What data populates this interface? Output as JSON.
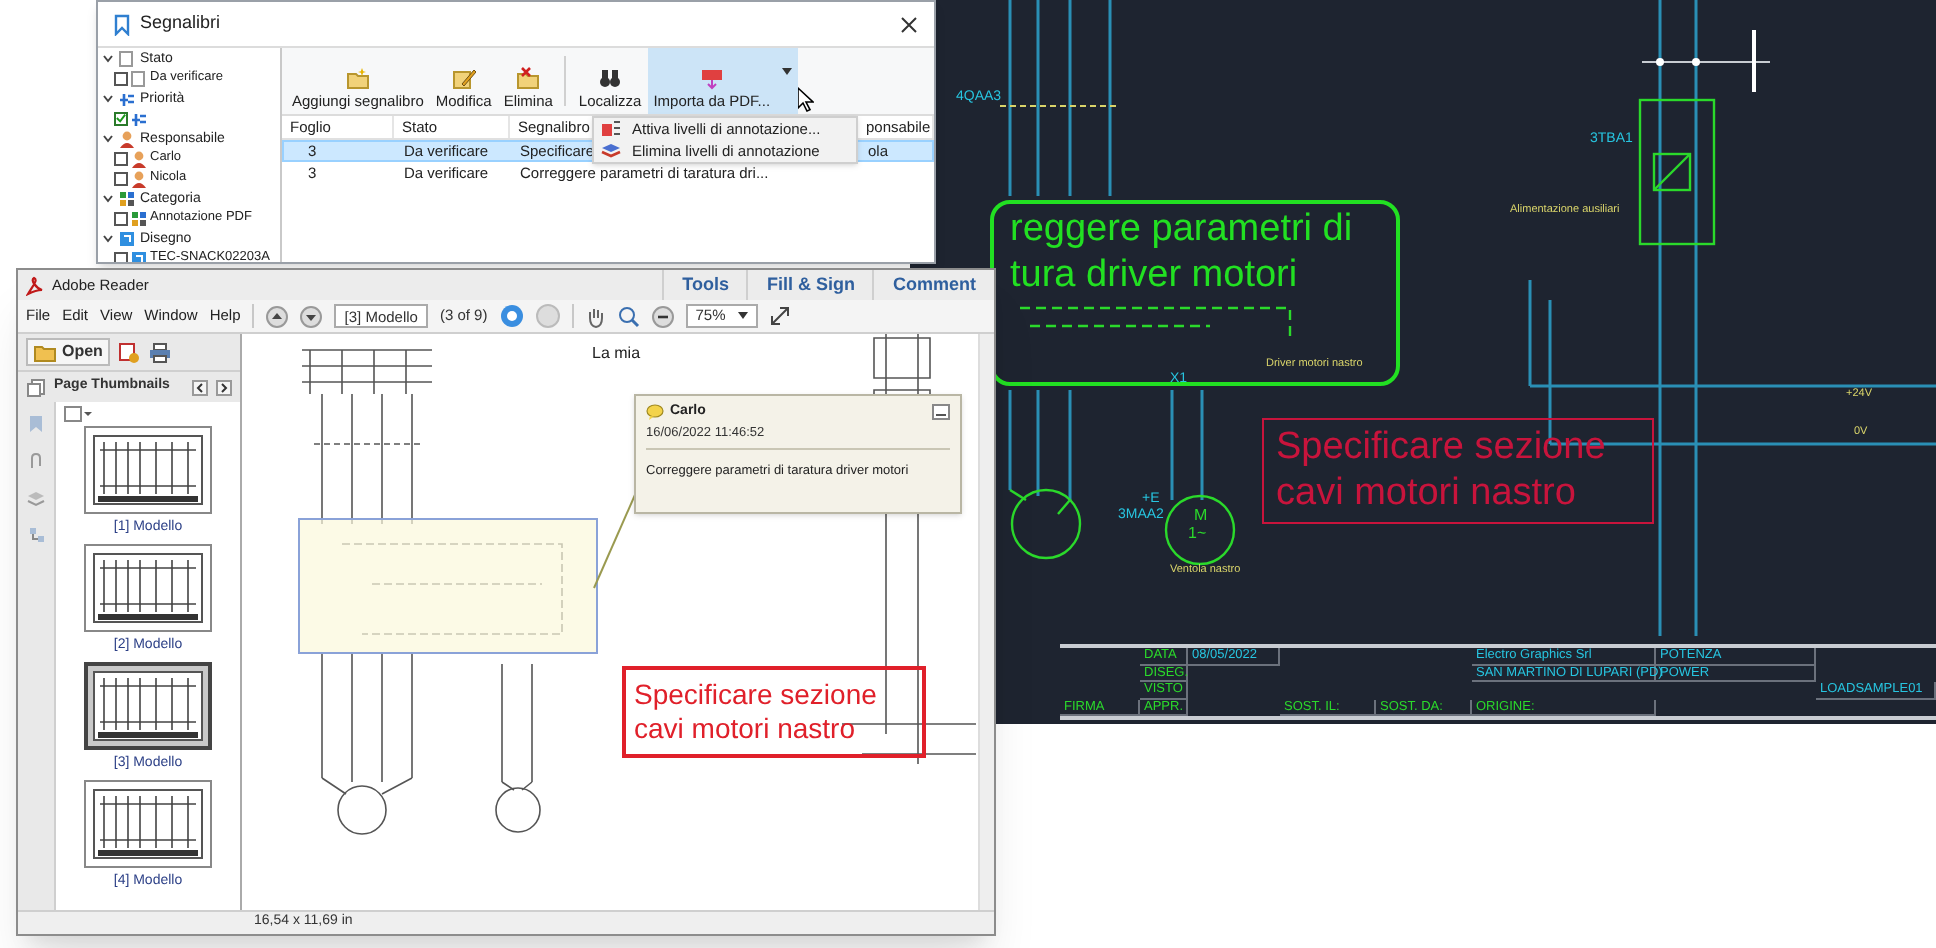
{
  "cad_drawing": {
    "labels": [
      {
        "text": "4QAA3",
        "kind": "tag"
      },
      {
        "text": "3TBA1",
        "kind": "tag"
      },
      {
        "text": "Alimentazione ausiliari",
        "kind": "note"
      },
      {
        "text": "Driver motori nastro",
        "kind": "note"
      },
      {
        "text": "X1",
        "kind": "tag"
      },
      {
        "text": "+E",
        "kind": "tag"
      },
      {
        "text": "3MAA2",
        "kind": "tag"
      },
      {
        "text": "M",
        "kind": "symbol"
      },
      {
        "text": "1~",
        "kind": "symbol"
      },
      {
        "text": "Ventola nastro",
        "kind": "note"
      },
      {
        "text": "+24V",
        "kind": "note"
      },
      {
        "text": "0V",
        "kind": "note"
      }
    ],
    "notes": [
      {
        "text": "reggere parametri di\ntura driver motori",
        "color": "#22e022"
      },
      {
        "text": "Specificare sezione\ncavi motori nastro",
        "color": "#c8143c"
      }
    ],
    "title_block": [
      {
        "text": "FIRMA",
        "kind": "label"
      },
      {
        "text": "DATA",
        "kind": "label"
      },
      {
        "text": "DISEG.",
        "kind": "label"
      },
      {
        "text": "VISTO",
        "kind": "label"
      },
      {
        "text": "APPR.",
        "kind": "label"
      },
      {
        "text": "08/05/2022",
        "kind": "value"
      },
      {
        "text": "SOST. IL:",
        "kind": "label"
      },
      {
        "text": "SOST. DA:",
        "kind": "label"
      },
      {
        "text": "Electro Graphics Srl",
        "kind": "value"
      },
      {
        "text": "SAN MARTINO DI LUPARI (PD)",
        "kind": "value"
      },
      {
        "text": "ORIGINE:",
        "kind": "label"
      },
      {
        "text": "POTENZA",
        "kind": "value"
      },
      {
        "text": "POWER",
        "kind": "value"
      },
      {
        "text": "LOADSAMPLE01",
        "kind": "value"
      }
    ]
  },
  "bookmarks_window": {
    "title": "Segnalibri",
    "tree": [
      {
        "label": "Stato",
        "expanded": true,
        "children": [
          {
            "label": "Da verificare",
            "checked": false
          }
        ]
      },
      {
        "label": "Priorità",
        "expanded": true,
        "children": [
          {
            "checked": true
          }
        ]
      },
      {
        "label": "Responsabile",
        "expanded": true,
        "children": [
          {
            "label": "Carlo",
            "checked": false
          },
          {
            "label": "Nicola",
            "checked": false
          }
        ]
      },
      {
        "label": "Categoria",
        "expanded": true,
        "children": [
          {
            "label": "Annotazione PDF",
            "checked": false
          }
        ]
      },
      {
        "label": "Disegno",
        "expanded": true,
        "children": [
          {
            "label": "TEC-SNACK02203A",
            "checked": false
          }
        ]
      }
    ],
    "toolbar": [
      {
        "label": "Aggiungi segnalibro",
        "selected": false
      },
      {
        "label": "Modifica",
        "selected": false
      },
      {
        "label": "Elimina",
        "selected": false
      },
      {
        "label": "Localizza",
        "selected": false
      },
      {
        "label": "Importa da PDF...",
        "selected": true
      }
    ],
    "menu": {
      "open": true,
      "items": [
        "Attiva livelli di annotazione...",
        "Elimina livelli di annotazione"
      ]
    },
    "table": {
      "columns": [
        "Foglio",
        "Stato",
        "Segnalibro",
        "ponsabile"
      ],
      "rows": [
        {
          "cells": [
            "3",
            "Da verificare",
            "Specificare",
            "ola"
          ],
          "selected": true
        },
        {
          "cells": [
            "3",
            "Da verificare",
            "Correggere parametri di taratura dri..."
          ],
          "selected": false
        }
      ]
    }
  },
  "pdf_viewer": {
    "title": "Adobe Reader",
    "tabs": [
      "Tools",
      "Fill & Sign",
      "Comment"
    ],
    "menu": [
      "File",
      "Edit",
      "View",
      "Window",
      "Help"
    ],
    "page_field": "[3] Modello",
    "page_count": "(3 of 9)",
    "zoom": "75%",
    "open_button": "Open",
    "panel_title": "Page Thumbnails",
    "thumbnails": [
      {
        "label": "[1] Modello",
        "selected": false
      },
      {
        "label": "[2] Modello",
        "selected": false
      },
      {
        "label": "[3] Modello",
        "selected": true
      },
      {
        "label": "[4] Modello",
        "selected": false
      }
    ],
    "page": {
      "heading": "La mia",
      "comment": {
        "author": "Carlo",
        "date": "16/06/2022 11:46:52",
        "text": "Correggere parametri di taratura driver motori"
      },
      "note": "Specificare sezione\ncavi motori nastro"
    },
    "page_size": "16,54 x 11,69 in"
  }
}
